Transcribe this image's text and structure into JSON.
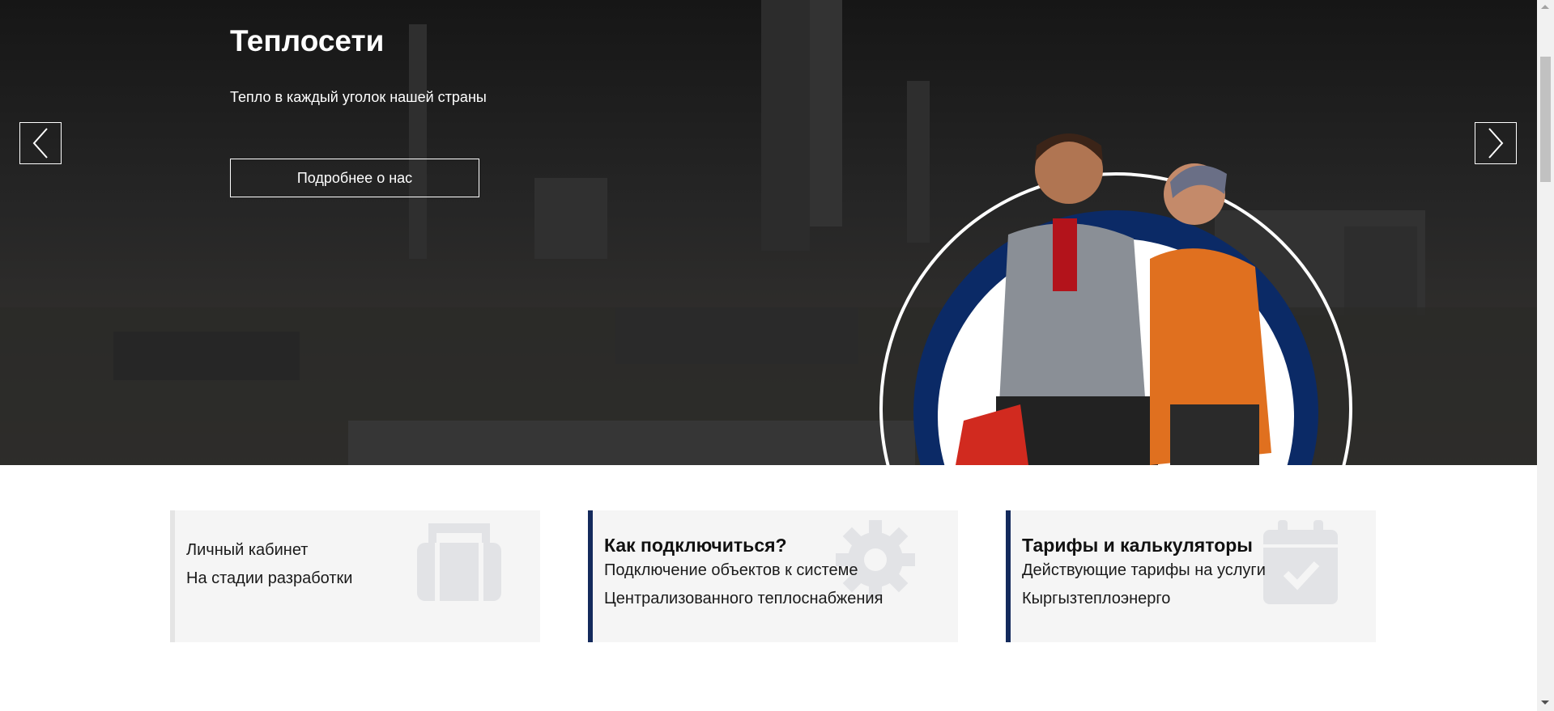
{
  "hero": {
    "title": "Теплосети",
    "subtitle": "Тепло в каждый уголок нашей страны",
    "button_label": "Подробнее о нас",
    "colors": {
      "ring_blue": "#0b2a66",
      "overlay": "#1f1f1f"
    }
  },
  "cards": [
    {
      "title": "",
      "lines": [
        "Личный кабинет",
        "На стадии разработки"
      ],
      "icon": "briefcase-icon",
      "accent": "#e4e4e4"
    },
    {
      "title": "Как подключиться?",
      "lines": [
        "Подключение объектов к системе",
        "Централизованного теплоснабжения"
      ],
      "icon": "gear-icon",
      "accent": "#142a5c"
    },
    {
      "title": "Тарифы и калькуляторы",
      "lines": [
        "Действующие тарифы на услуги",
        "Кыргызтеплоэнерго"
      ],
      "icon": "calendar-check-icon",
      "accent": "#142a5c"
    }
  ]
}
